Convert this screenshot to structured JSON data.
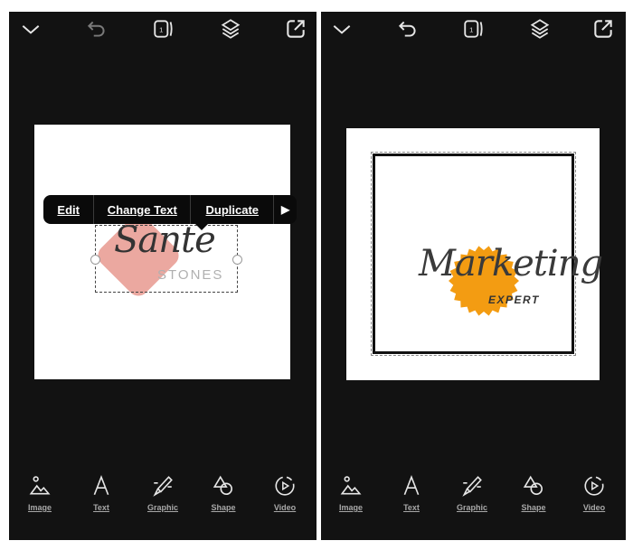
{
  "colors": {
    "panel_bg": "#121212",
    "icon": "#e6e6e6",
    "icon_disabled": "#7a7a7a",
    "popup_bg": "#0a0a0a",
    "accent_pink": "#eba8a0",
    "accent_orange": "#f39c12"
  },
  "screens": [
    {
      "id": "left",
      "topbar": {
        "icons": [
          {
            "name": "collapse",
            "icon": "chevron-down-icon"
          },
          {
            "name": "undo",
            "icon": "undo-icon",
            "disabled": true
          },
          {
            "name": "pages",
            "icon": "pages-icon",
            "page_number": "1"
          },
          {
            "name": "layers",
            "icon": "layers-icon"
          },
          {
            "name": "export",
            "icon": "export-icon"
          }
        ]
      },
      "design": {
        "logo_script": "Sante",
        "logo_subtitle": "STONES"
      },
      "popup": {
        "items": [
          "Edit",
          "Change Text",
          "Duplicate"
        ],
        "more_glyph": "▶"
      },
      "bottombar": {
        "tools": [
          "Image",
          "Text",
          "Graphic",
          "Shape",
          "Video"
        ]
      }
    },
    {
      "id": "right",
      "topbar": {
        "icons": [
          {
            "name": "collapse",
            "icon": "chevron-down-icon"
          },
          {
            "name": "undo",
            "icon": "undo-icon",
            "disabled": false
          },
          {
            "name": "pages",
            "icon": "pages-icon",
            "page_number": "1"
          },
          {
            "name": "layers",
            "icon": "layers-icon"
          },
          {
            "name": "export",
            "icon": "export-icon"
          }
        ]
      },
      "design": {
        "logo_script": "Marketing",
        "logo_subtitle": "EXPERT"
      },
      "bottombar": {
        "tools": [
          "Image",
          "Text",
          "Graphic",
          "Shape",
          "Video"
        ]
      }
    }
  ]
}
